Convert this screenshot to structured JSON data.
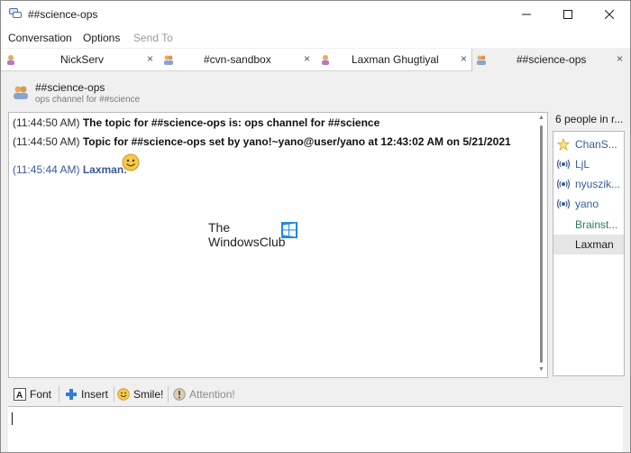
{
  "window": {
    "title": "##science-ops"
  },
  "menu": {
    "conversation": "Conversation",
    "options": "Options",
    "send_to": "Send To"
  },
  "tabs": [
    {
      "label": "NickServ",
      "close": "×"
    },
    {
      "label": "#cvn-sandbox",
      "close": "×"
    },
    {
      "label": "Laxman Ghugtiyal",
      "close": "×"
    },
    {
      "label": "##science-ops",
      "close": "×"
    }
  ],
  "channel": {
    "name": "##science-ops",
    "topic": "ops channel for ##science"
  },
  "messages": [
    {
      "time": "(11:44:50 AM)",
      "text": "The topic for ##science-ops is: ops channel for ##science"
    },
    {
      "time": "(11:44:50 AM)",
      "text": "Topic for ##science-ops set by yano!~yano@user/yano at 12:43:02 AM on 5/21/2021"
    },
    {
      "time": "(11:45:44 AM)",
      "nick": "Laxman:",
      "emote": "smiley"
    }
  ],
  "watermark": {
    "line1": "The",
    "line2": "WindowsClub"
  },
  "people": {
    "count_label": "6 people in r...",
    "list": [
      {
        "name": "ChanS...",
        "icon": "star-icon",
        "color": "#3a5a9a"
      },
      {
        "name": "LjL",
        "icon": "broadcast-icon",
        "color": "#3a5a9a"
      },
      {
        "name": "nyuszik...",
        "icon": "broadcast-icon",
        "color": "#3a5a9a"
      },
      {
        "name": "yano",
        "icon": "broadcast-icon",
        "color": "#3a5a9a"
      },
      {
        "name": "Brainst...",
        "icon": "",
        "color": "#2e7d5a"
      },
      {
        "name": "Laxman",
        "icon": "",
        "color": "#1b1b1b"
      }
    ]
  },
  "toolbar": {
    "font": "Font",
    "insert": "Insert",
    "smile": "Smile!",
    "attention": "Attention!"
  },
  "input": {
    "value": ""
  },
  "colors": {
    "nick": "#3a5a9a",
    "voice_green": "#2e7d5a",
    "accent_blue": "#0078d4"
  }
}
